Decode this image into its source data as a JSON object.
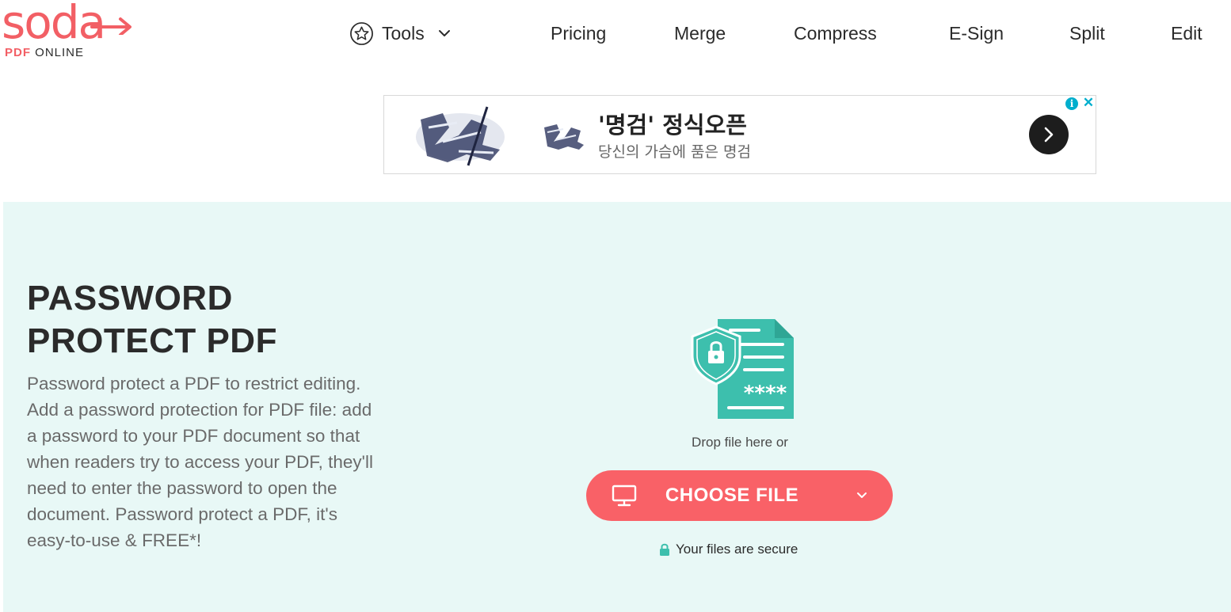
{
  "brand": {
    "word": "soda",
    "sub_pdf": "PDF",
    "sub_online": "ONLINE",
    "color": "#f25f65"
  },
  "nav": {
    "tools_label": "Tools",
    "items": [
      "Pricing",
      "Merge",
      "Compress",
      "E-Sign",
      "Split",
      "Edit"
    ]
  },
  "ad": {
    "title": "'명검' 정식오픈",
    "subtitle": "당신의 가슴에 품은 명검",
    "info_glyph": "i",
    "close_glyph": "✕"
  },
  "hero": {
    "title_line1": "PASSWORD",
    "title_line2": "PROTECT PDF",
    "description": "Password protect a PDF to restrict editing. Add a password protection for PDF file: add a password to your PDF document so that when readers try to access your PDF, they'll need to enter the password to open the document. Password protect a PDF, it's easy-to-use & FREE*!",
    "drop_text": "Drop file here or",
    "choose_button": "CHOOSE FILE",
    "secure_text": "Your files are secure",
    "accent": "#3dbfad",
    "button_color": "#f96167",
    "background": "#e8f8f6"
  }
}
